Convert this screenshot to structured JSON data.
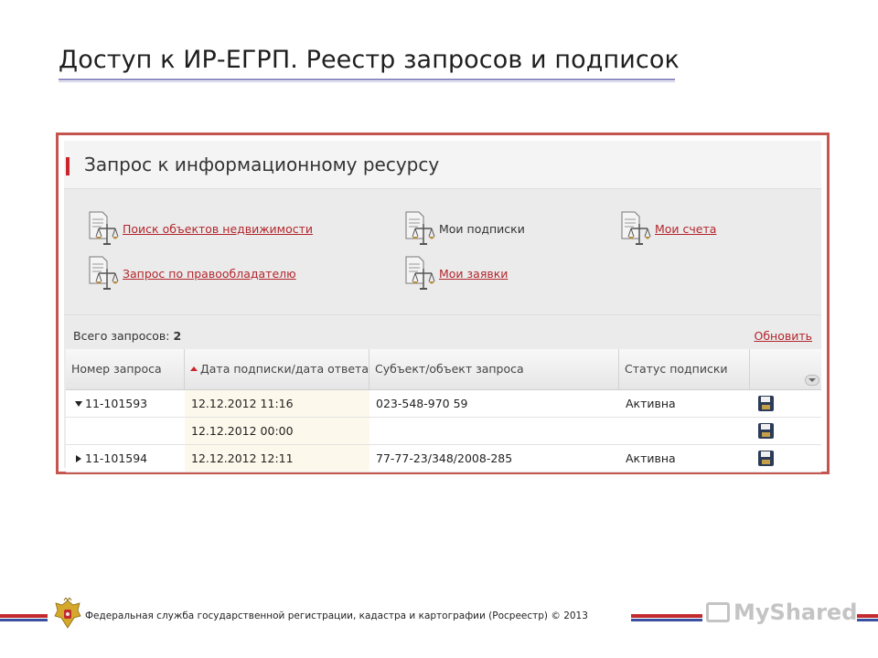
{
  "slide": {
    "title": "Доступ к ИР-ЕГРП. Реестр запросов и подписок"
  },
  "panel": {
    "title": "Запрос к информационному ресурсу",
    "links": [
      {
        "label": "Поиск объектов недвижимости",
        "icon": "document-scales-icon",
        "is_link": true
      },
      {
        "label": "Мои подписки",
        "icon": "document-scales-icon",
        "is_link": false
      },
      {
        "label": "Мои счета",
        "icon": "document-scales-icon",
        "is_link": true
      },
      {
        "label": "Запрос по правообладателю",
        "icon": "document-scales-icon",
        "is_link": true
      },
      {
        "label": "Мои заявки",
        "icon": "document-scales-icon",
        "is_link": true
      }
    ],
    "total_label": "Всего запросов:",
    "total_count": "2",
    "refresh_label": "Обновить"
  },
  "table": {
    "columns": [
      "Номер запроса",
      "Дата подписки/дата ответа",
      "Субъект/объект запроса",
      "Статус подписки"
    ],
    "sorted_column": "Дата подписки/дата ответа",
    "rows": [
      {
        "number": "11-101593",
        "expanded": true,
        "date": "12.12.2012 11:16",
        "subject": "023-548-970 59",
        "status": "Активна",
        "icon": "save-icon"
      },
      {
        "number": "",
        "date": "12.12.2012 00:00",
        "subject": "",
        "status": "",
        "icon": "save-icon"
      },
      {
        "number": "11-101594",
        "expanded": false,
        "date": "12.12.2012 12:11",
        "subject": "77-77-23/348/2008-285",
        "status": "Активна",
        "icon": "save-icon"
      }
    ]
  },
  "footer": {
    "text": "Федеральная служба государственной регистрации, кадастра и картографии (Росреестр) © 2013",
    "emblem": "coat-of-arms-icon",
    "watermark": "MyShared"
  },
  "colors": {
    "accent_red": "#c9252c",
    "frame_border": "#c5564f",
    "link": "#b3262c",
    "footer_blue": "#3a4fa0"
  }
}
